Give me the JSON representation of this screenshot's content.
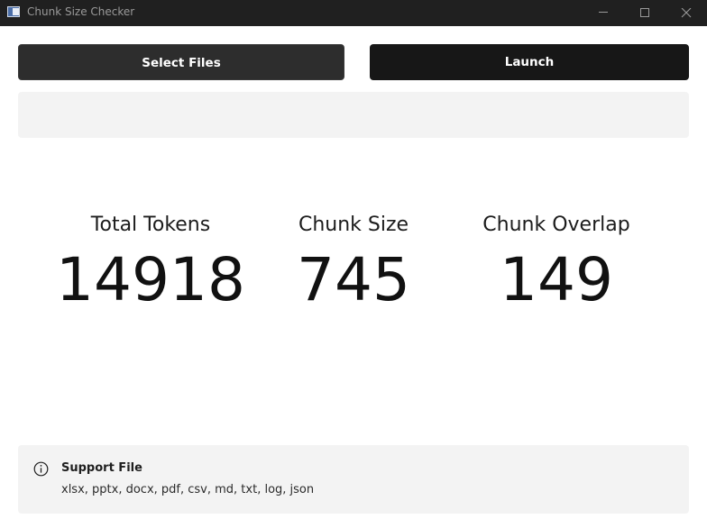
{
  "window": {
    "title": "Chunk Size Checker",
    "controls": {
      "minimize_icon": "minimize-icon",
      "maximize_icon": "maximize-icon",
      "close_icon": "close-icon"
    }
  },
  "toolbar": {
    "select_files_label": "Select Files",
    "launch_label": "Launch"
  },
  "file_list": {
    "value": ""
  },
  "stats": [
    {
      "label": "Total Tokens",
      "value": "14918"
    },
    {
      "label": "Chunk Size",
      "value": "745"
    },
    {
      "label": "Chunk Overlap",
      "value": "149"
    }
  ],
  "info": {
    "icon": "info-icon",
    "title": "Support File",
    "message": "xlsx, pptx, docx, pdf, csv, md, txt, log, json"
  },
  "colors": {
    "titlebar": "#202020",
    "button_dark": "#2d2d2d",
    "button_accent": "#171717",
    "panel": "#f3f3f3"
  }
}
